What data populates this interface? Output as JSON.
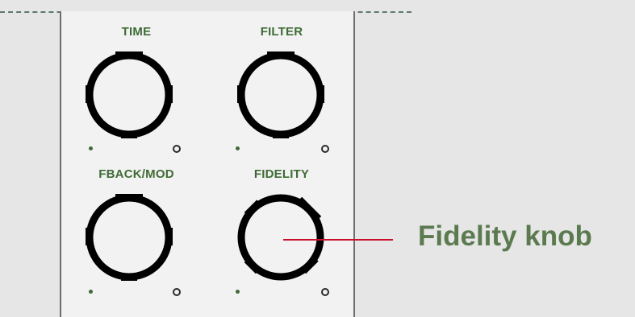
{
  "knobs": [
    {
      "label": "TIME"
    },
    {
      "label": "FILTER"
    },
    {
      "label": "FBACK/MOD"
    },
    {
      "label": "FIDELITY"
    }
  ],
  "callout": {
    "text": "Fidelity knob"
  },
  "colors": {
    "label": "#3e6b35",
    "callout_text": "#5c7a4f",
    "callout_line": "#c8102e",
    "knob": "#000000",
    "background": "#e6e6e6",
    "panel": "#f2f2f2"
  }
}
